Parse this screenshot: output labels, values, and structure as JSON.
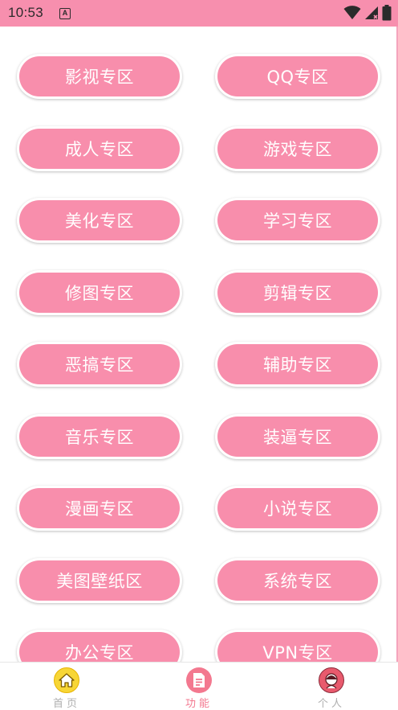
{
  "status_bar": {
    "time": "10:53",
    "notification_icon": "a-letter-icon",
    "icons": [
      "wifi-icon",
      "signal-icon",
      "battery-icon"
    ]
  },
  "colors": {
    "accent": "#f88eac",
    "status_bar": "#f78fae",
    "home_icon": "#f7d636",
    "active_tab_icon": "#f3788f",
    "profile_icon": "#e85a6d",
    "nav_label_inactive": "#b0b0b0",
    "nav_label_active": "#f3788f"
  },
  "zones": {
    "left": [
      "影视专区",
      "成人专区",
      "美化专区",
      "修图专区",
      "恶搞专区",
      "音乐专区",
      "漫画专区",
      "美图壁纸区",
      "办公专区"
    ],
    "right": [
      "QQ专区",
      "游戏专区",
      "学习专区",
      "剪辑专区",
      "辅助专区",
      "装逼专区",
      "小说专区",
      "系统专区",
      "VPN专区"
    ]
  },
  "bottom_nav": {
    "items": [
      {
        "label": "首页",
        "icon": "home-icon",
        "active": false
      },
      {
        "label": "功能",
        "icon": "function-list-icon",
        "active": true
      },
      {
        "label": "个人",
        "icon": "profile-icon",
        "active": false
      }
    ]
  }
}
